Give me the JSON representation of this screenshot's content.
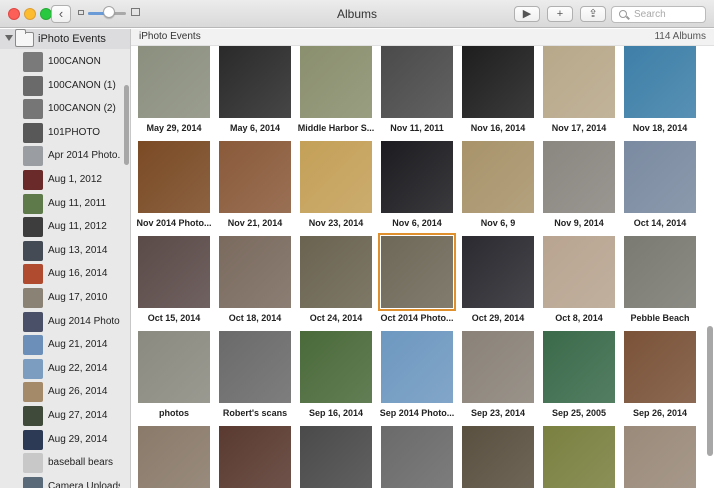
{
  "window": {
    "title": "Albums",
    "back_label": "‹",
    "play_label": "▶",
    "add_label": "+",
    "share_label": "⇪",
    "search_placeholder": "Search",
    "zoom_level": 0.55
  },
  "sidebar": {
    "header": "iPhoto Events",
    "items": [
      {
        "label": "100CANON",
        "color": "#7a7a7a"
      },
      {
        "label": "100CANON (1)",
        "color": "#6a6a6a"
      },
      {
        "label": "100CANON (2)",
        "color": "#767676"
      },
      {
        "label": "101PHOTO",
        "color": "#585858"
      },
      {
        "label": "Apr 2014 Photo...",
        "color": "#9a9ea3"
      },
      {
        "label": "Aug 1, 2012",
        "color": "#6b2a2a"
      },
      {
        "label": "Aug 11, 2011",
        "color": "#5f7a4a"
      },
      {
        "label": "Aug 11, 2012",
        "color": "#3d3d3d"
      },
      {
        "label": "Aug 13, 2014",
        "color": "#444b55"
      },
      {
        "label": "Aug 16, 2014",
        "color": "#b04b2f"
      },
      {
        "label": "Aug 17, 2010",
        "color": "#8a8375"
      },
      {
        "label": "Aug 2014 Photo...",
        "color": "#4a5068"
      },
      {
        "label": "Aug 21, 2014",
        "color": "#6b8fb8"
      },
      {
        "label": "Aug 22, 2014",
        "color": "#7c9cc0"
      },
      {
        "label": "Aug 26, 2014",
        "color": "#a58a6a"
      },
      {
        "label": "Aug 27, 2014",
        "color": "#3f4a3a"
      },
      {
        "label": "Aug 29, 2014",
        "color": "#2d3a55"
      },
      {
        "label": "baseball bears",
        "color": "#c8c8c8"
      },
      {
        "label": "Camera Uploads",
        "color": "#5a6a78"
      }
    ]
  },
  "main": {
    "title": "iPhoto Events",
    "count": "114 Albums",
    "events": [
      {
        "label": "May 29, 2014",
        "color": "#8b8f7e"
      },
      {
        "label": "May 6, 2014",
        "color": "#2a2a2a"
      },
      {
        "label": "Middle Harbor S...",
        "color": "#8a8f6e"
      },
      {
        "label": "Nov 11, 2011",
        "color": "#4a4a4a"
      },
      {
        "label": "Nov 16, 2014",
        "color": "#1e1e1e"
      },
      {
        "label": "Nov 17, 2014",
        "color": "#b8a88a"
      },
      {
        "label": "Nov 18, 2014",
        "color": "#3e7fa8"
      },
      {
        "label": "Nov 2014 Photo...",
        "color": "#7a4a24"
      },
      {
        "label": "Nov 21, 2014",
        "color": "#8a5a3a"
      },
      {
        "label": "Nov 23, 2014",
        "color": "#c4a058"
      },
      {
        "label": "Nov 6, 2014",
        "color": "#1c1c20"
      },
      {
        "label": "Nov 6, 9",
        "color": "#a8936a"
      },
      {
        "label": "Nov 9, 2014",
        "color": "#8a8680"
      },
      {
        "label": "Oct 14, 2014",
        "color": "#7a8aa0"
      },
      {
        "label": "Oct 15, 2014",
        "color": "#5a4a48"
      },
      {
        "label": "Oct 18, 2014",
        "color": "#7a6a5e"
      },
      {
        "label": "Oct 24, 2014",
        "color": "#6a6350"
      },
      {
        "label": "Oct 2014 Photo...",
        "color": "#6e6858",
        "selected": true
      },
      {
        "label": "Oct 29, 2014",
        "color": "#2a2a30"
      },
      {
        "label": "Oct 8, 2014",
        "color": "#b8a490"
      },
      {
        "label": "Pebble Beach",
        "color": "#7a7a72"
      },
      {
        "label": "photos",
        "color": "#8a8a80"
      },
      {
        "label": "Robert's scans",
        "color": "#6a6a6a"
      },
      {
        "label": "Sep 16, 2014",
        "color": "#4a6a3a"
      },
      {
        "label": "Sep 2014 Photo...",
        "color": "#6e98c0"
      },
      {
        "label": "Sep 23, 2014",
        "color": "#8a8278"
      },
      {
        "label": "Sep 25, 2005",
        "color": "#3a6a4a"
      },
      {
        "label": "Sep 26, 2014",
        "color": "#7a5238"
      },
      {
        "label": "",
        "color": "#8a7a6a"
      },
      {
        "label": "",
        "color": "#5a3a30"
      },
      {
        "label": "",
        "color": "#4a4a4a"
      },
      {
        "label": "",
        "color": "#6a6a6a"
      },
      {
        "label": "",
        "color": "#5a5040"
      },
      {
        "label": "",
        "color": "#7a8040"
      },
      {
        "label": "",
        "color": "#9a8a7a"
      }
    ]
  }
}
